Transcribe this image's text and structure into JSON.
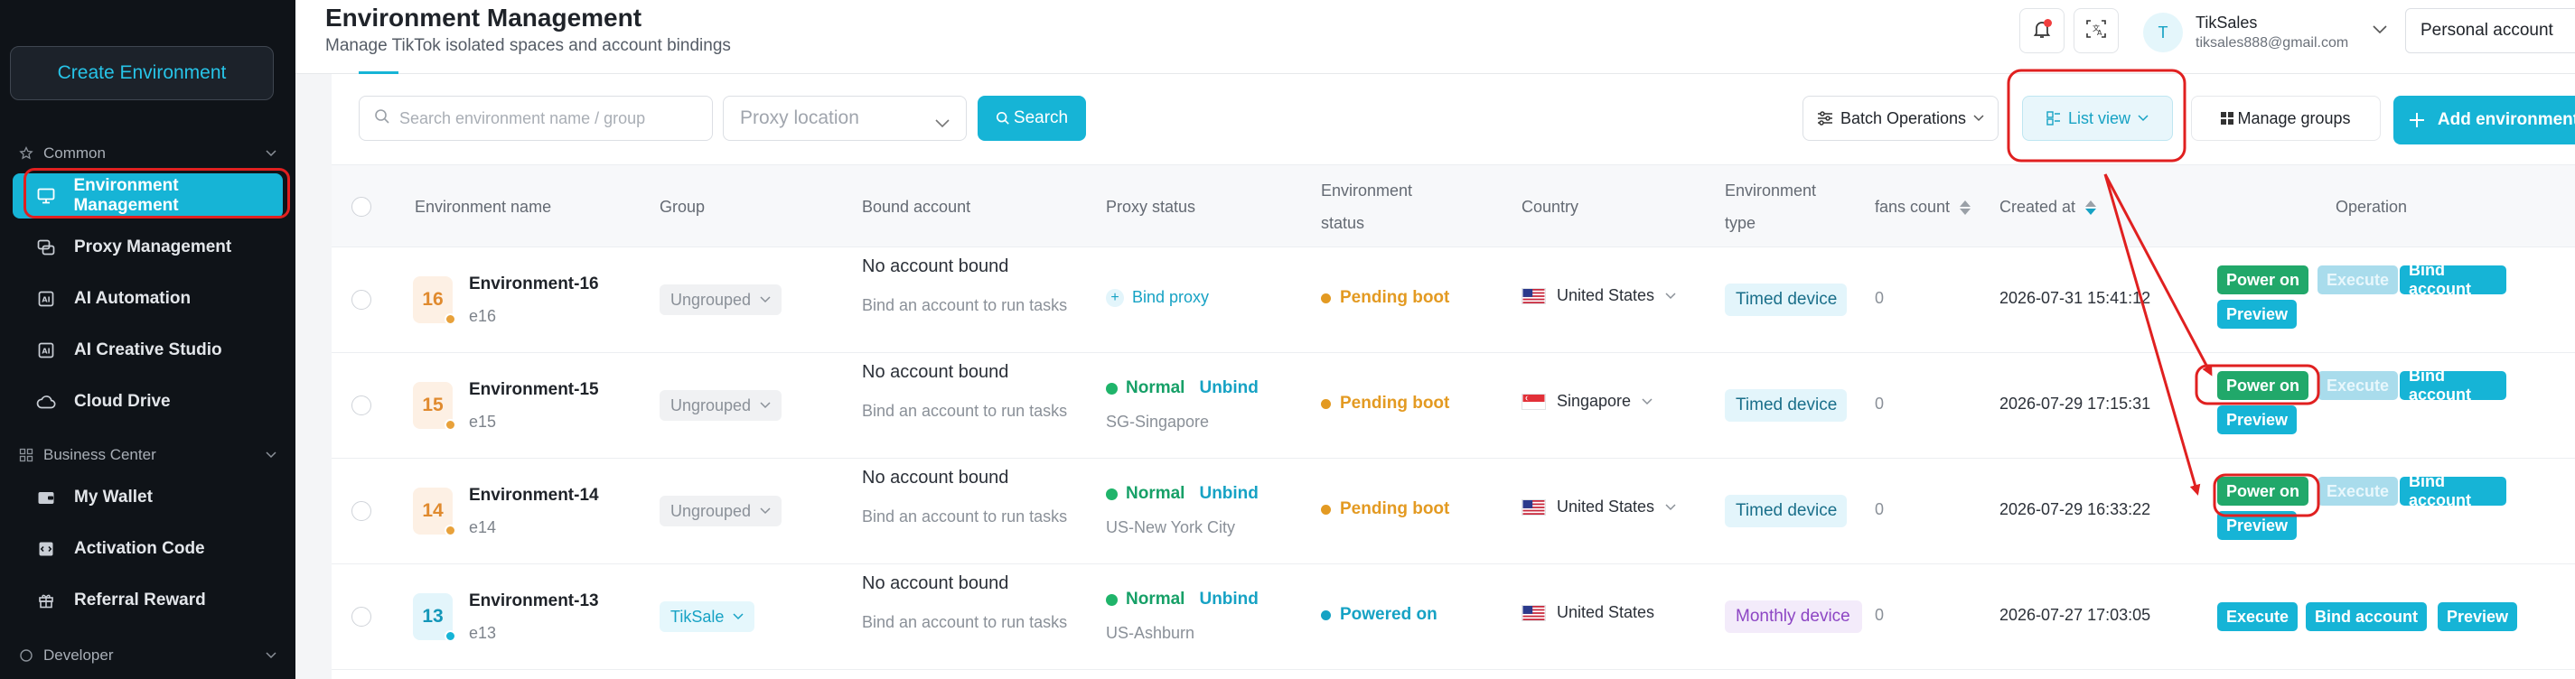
{
  "sidebar": {
    "create_button": "Create Environment",
    "sections": [
      {
        "label": "Common",
        "icon": "star-icon"
      },
      {
        "label": "Business Center",
        "icon": "grid-icon"
      },
      {
        "label": "Developer",
        "icon": "circle-icon"
      }
    ],
    "items": [
      {
        "label": "Environment Management",
        "icon": "monitor-icon",
        "active": true
      },
      {
        "label": "Proxy Management",
        "icon": "proxy-icon"
      },
      {
        "label": "AI Automation",
        "icon": "ai-icon"
      },
      {
        "label": "AI Creative Studio",
        "icon": "ai-icon"
      },
      {
        "label": "Cloud Drive",
        "icon": "cloud-icon"
      },
      {
        "label": "My Wallet",
        "icon": "wallet-icon"
      },
      {
        "label": "Activation Code",
        "icon": "code-icon"
      },
      {
        "label": "Referral Reward",
        "icon": "gift-icon"
      }
    ]
  },
  "header": {
    "title": "Environment Management",
    "subtitle": "Manage TikTok isolated spaces and account bindings",
    "user_initial": "T",
    "user_name": "TikSales",
    "user_email": "tiksales888@gmail.com",
    "account_type": "Personal account"
  },
  "toolbar": {
    "search_placeholder": "Search environment name / group",
    "proxy_placeholder": "Proxy location",
    "search_button": "Search",
    "batch_operations": "Batch Operations",
    "list_view": "List view",
    "manage_groups": "Manage groups",
    "add_environment": "Add environment"
  },
  "table": {
    "columns": {
      "name": "Environment name",
      "group": "Group",
      "bound_account": "Bound account",
      "proxy_status": "Proxy status",
      "env_status_1": "Environment",
      "env_status_2": "status",
      "country": "Country",
      "env_type_1": "Environment",
      "env_type_2": "type",
      "fans": "fans count",
      "created": "Created at",
      "operation": "Operation"
    },
    "rows": [
      {
        "num": "16",
        "badge_color": "orange",
        "dot_color": "#e8a13a",
        "name": "Environment-16",
        "id": "e16",
        "group": "Ungrouped",
        "group_style": "gray",
        "account_main": "No account bound",
        "account_sub": "Bind an account to run tasks",
        "proxy_mode": "bind",
        "bind_proxy": "Bind proxy",
        "env_status": "Pending boot",
        "env_status_color": "#e39a22",
        "country": "United States",
        "flag": "us",
        "type": "Timed device",
        "type_style": "timed",
        "fans": "0",
        "created": "2026-07-31 15:41:12",
        "ops": [
          "Power on",
          "Execute",
          "Bind account",
          "Preview"
        ],
        "ops_layout": "power"
      },
      {
        "num": "15",
        "badge_color": "orange",
        "dot_color": "#e8a13a",
        "name": "Environment-15",
        "id": "e15",
        "group": "Ungrouped",
        "group_style": "gray",
        "account_main": "No account bound",
        "account_sub": "Bind an account to run tasks",
        "proxy_mode": "normal",
        "proxy_normal": "Normal",
        "proxy_unbind": "Unbind",
        "proxy_loc": "SG-Singapore",
        "env_status": "Pending boot",
        "env_status_color": "#e39a22",
        "country": "Singapore",
        "flag": "sg",
        "type": "Timed device",
        "type_style": "timed",
        "fans": "0",
        "created": "2026-07-29 17:15:31",
        "ops": [
          "Power on",
          "Execute",
          "Bind account",
          "Preview"
        ],
        "ops_layout": "power"
      },
      {
        "num": "14",
        "badge_color": "orange",
        "dot_color": "#e8a13a",
        "name": "Environment-14",
        "id": "e14",
        "group": "Ungrouped",
        "group_style": "gray",
        "account_main": "No account bound",
        "account_sub": "Bind an account to run tasks",
        "proxy_mode": "normal",
        "proxy_normal": "Normal",
        "proxy_unbind": "Unbind",
        "proxy_loc": "US-New York City",
        "env_status": "Pending boot",
        "env_status_color": "#e39a22",
        "country": "United States",
        "flag": "us",
        "type": "Timed device",
        "type_style": "timed",
        "fans": "0",
        "created": "2026-07-29 16:33:22",
        "ops": [
          "Power on",
          "Execute",
          "Bind account",
          "Preview"
        ],
        "ops_layout": "power"
      },
      {
        "num": "13",
        "badge_color": "blue",
        "dot_color": "#16b4d6",
        "name": "Environment-13",
        "id": "e13",
        "group": "TikSale",
        "group_style": "cyan",
        "account_main": "No account bound",
        "account_sub": "Bind an account to run tasks",
        "proxy_mode": "normal",
        "proxy_normal": "Normal",
        "proxy_unbind": "Unbind",
        "proxy_loc": "US-Ashburn",
        "env_status": "Powered on",
        "env_status_color": "#16a2c4",
        "country": "United States",
        "flag": "us",
        "type": "Monthly device",
        "type_style": "monthly",
        "fans": "0",
        "created": "2026-07-27 17:03:05",
        "ops": [
          "Execute",
          "Bind account",
          "Preview"
        ],
        "ops_layout": "on"
      }
    ]
  },
  "colors": {
    "accent": "#16b4d6",
    "sidebar_bg": "#0f1318",
    "annotation_red": "#e02020",
    "power_green": "#21a86a"
  }
}
